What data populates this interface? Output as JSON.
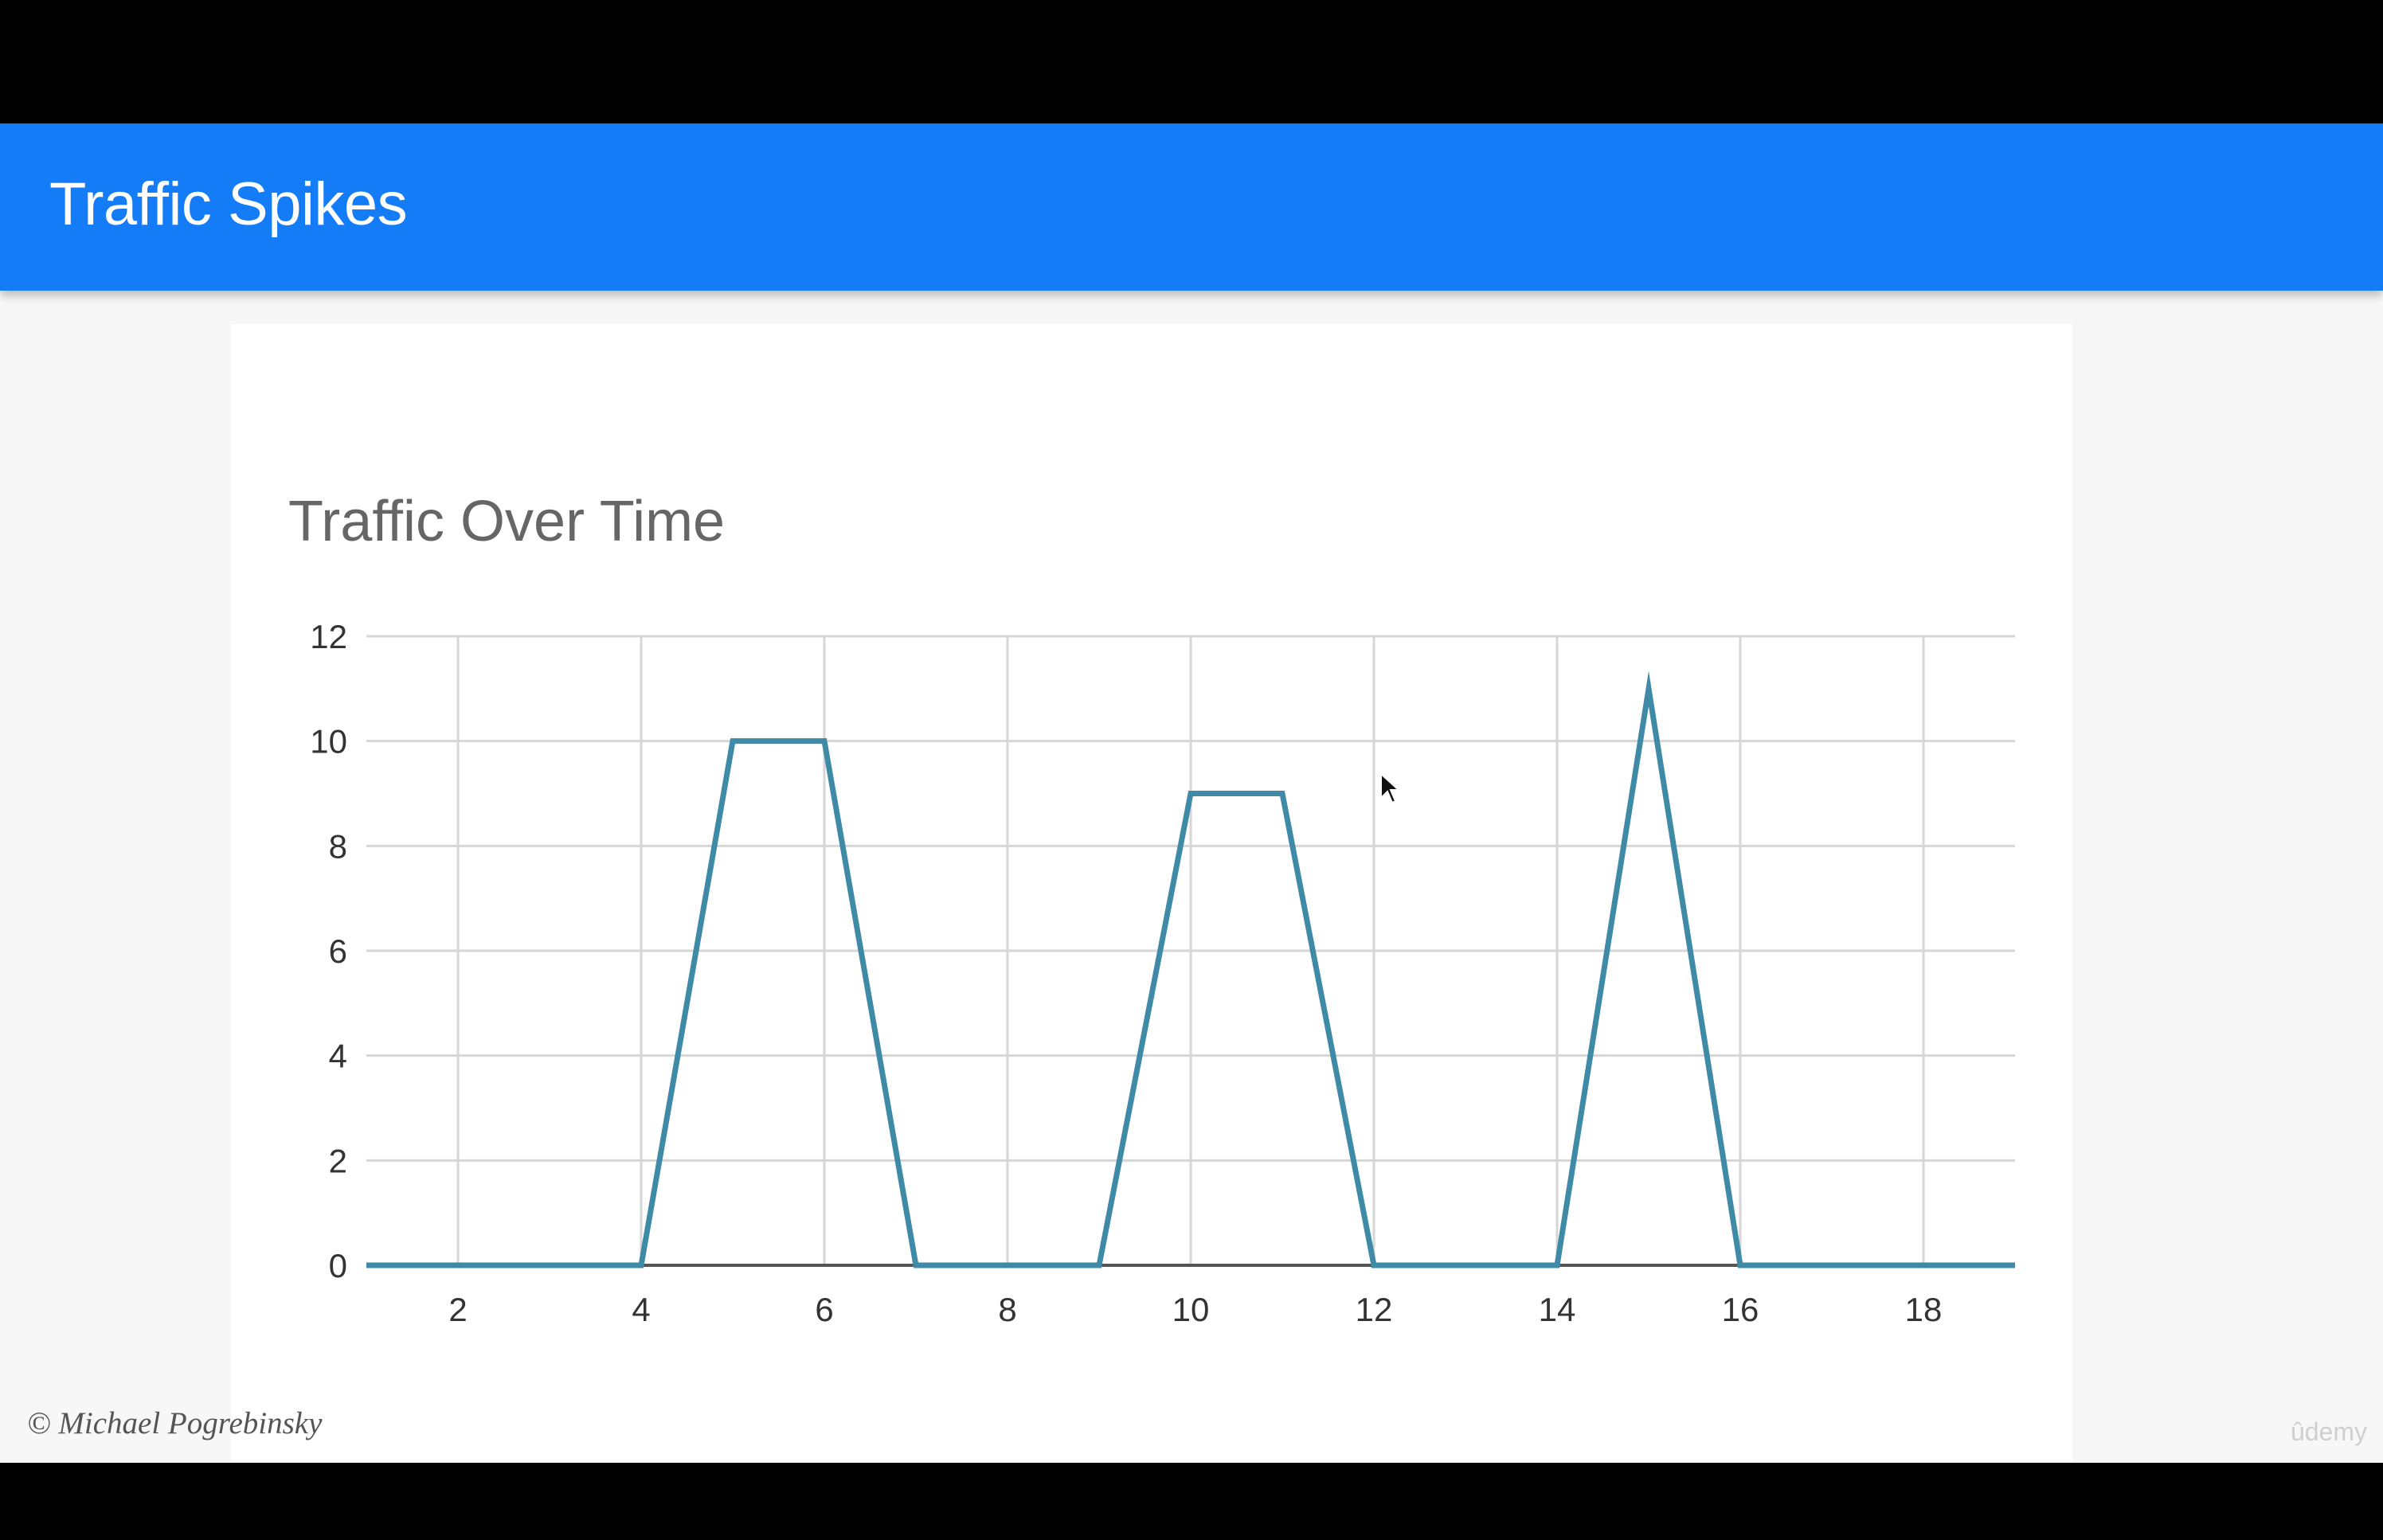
{
  "header": {
    "title": "Traffic Spikes"
  },
  "footer": {
    "copyright": "© Michael Pogrebinsky",
    "watermark": "ûdemy"
  },
  "colors": {
    "header_bg": "#157cf8",
    "line": "#3f8aa6",
    "grid": "#d6d6d6",
    "axis": "#555555"
  },
  "chart_data": {
    "type": "line",
    "title": "Traffic Over Time",
    "xlabel": "",
    "ylabel": "",
    "xlim": [
      1,
      19
    ],
    "ylim": [
      0,
      12
    ],
    "xticks": [
      2,
      4,
      6,
      8,
      10,
      12,
      14,
      16,
      18
    ],
    "yticks": [
      0,
      2,
      4,
      6,
      8,
      10,
      12
    ],
    "grid": true,
    "series": [
      {
        "x": [
          1,
          2,
          3,
          4,
          5,
          6,
          7,
          8,
          9,
          10,
          11,
          12,
          13,
          14,
          15,
          16,
          17,
          18,
          19
        ],
        "y": [
          0,
          0,
          0,
          0,
          10,
          10,
          0,
          0,
          0,
          9,
          9,
          0,
          0,
          0,
          11,
          0,
          0,
          0,
          0
        ]
      }
    ]
  }
}
